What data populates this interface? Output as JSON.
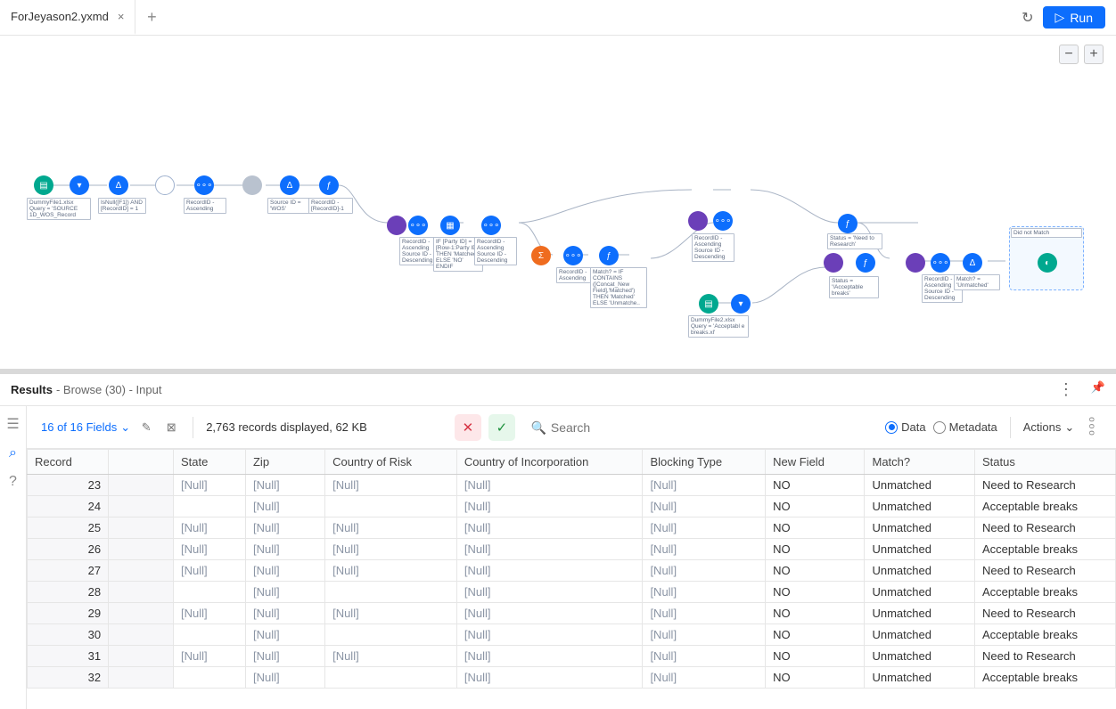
{
  "tabs": [
    {
      "label": "ForJeyason2.yxmd"
    }
  ],
  "run_label": "Run",
  "canvas": {
    "nodes": {
      "input1_label": "DummyFile1.xlsx\nQuery = 'SOURCE\n1D_WOS_Record",
      "formula1_label": "IsNull([F1])\nAND\n[RecordID] = 1",
      "sort1_label": "RecordID -\nAscending",
      "select1_label": "Source ID =\n'WOS'",
      "formula2_label": "RecordID -\n[RecordID]-1",
      "sort2_label": "RecordID -\nAscending\nSource ID -\nDescending",
      "if_label": "IF [Party ID] =\n[Row-1:Party ID]\nTHEN 'Matched'\nELSE 'NO'\nENDIF",
      "sort3_label": "RecordID -\nAscending\nSource ID -\nDescending",
      "sort4_label": "RecordID -\nAscending",
      "match_label": "Match? = IF\nCONTAINS\n([Concat_New\nField],'Matched')\nTHEN 'Matched'\nELSE 'Unmatche..",
      "sort5_label": "RecordID -\nAscending\nSource ID -\nDescending",
      "input2_label": "DummyFile2.xlsx\nQuery = 'Acceptabl\ne breaks.xl'",
      "status1_label": "Status = 'Need to\nResearch'",
      "status2_label": "Status =\n'!Acceptable\nbreaks'",
      "sort6_label": "RecordID -\nAscending\nSource ID -\nDescending",
      "match2_label": "Match? =\n'Unmatched'",
      "container_label": "Did not Match"
    }
  },
  "results": {
    "title_bold": "Results",
    "title_rest": "- Browse (30) - Input",
    "fields_link": "16 of 16 Fields",
    "records_text": "2,763 records displayed, 62 KB",
    "search_placeholder": "Search",
    "view_data": "Data",
    "view_metadata": "Metadata",
    "actions_label": "Actions",
    "more_label": "ooo"
  },
  "table": {
    "columns": [
      "Record",
      "",
      "State",
      "Zip",
      "Country of Risk",
      "Country of Incorporation",
      "Blocking Type",
      "New Field",
      "Match?",
      "Status"
    ],
    "rows": [
      {
        "rec": "23",
        "state": "[Null]",
        "zip": "[Null]",
        "cor": "[Null]",
        "coi": "[Null]",
        "bt": "[Null]",
        "nf": "NO",
        "match": "Unmatched",
        "status": "Need to Research"
      },
      {
        "rec": "24",
        "state": "",
        "zip": "[Null]",
        "cor": "",
        "coi": "[Null]",
        "bt": "[Null]",
        "nf": "NO",
        "match": "Unmatched",
        "status": "Acceptable breaks"
      },
      {
        "rec": "25",
        "state": "[Null]",
        "zip": "[Null]",
        "cor": "[Null]",
        "coi": "[Null]",
        "bt": "[Null]",
        "nf": "NO",
        "match": "Unmatched",
        "status": "Need to Research"
      },
      {
        "rec": "26",
        "state": "[Null]",
        "zip": "[Null]",
        "cor": "[Null]",
        "coi": "[Null]",
        "bt": "[Null]",
        "nf": "NO",
        "match": "Unmatched",
        "status": "Acceptable breaks"
      },
      {
        "rec": "27",
        "state": "[Null]",
        "zip": "[Null]",
        "cor": "[Null]",
        "coi": "[Null]",
        "bt": "[Null]",
        "nf": "NO",
        "match": "Unmatched",
        "status": "Need to Research"
      },
      {
        "rec": "28",
        "state": "",
        "zip": "[Null]",
        "cor": "",
        "coi": "[Null]",
        "bt": "[Null]",
        "nf": "NO",
        "match": "Unmatched",
        "status": "Acceptable breaks"
      },
      {
        "rec": "29",
        "state": "[Null]",
        "zip": "[Null]",
        "cor": "[Null]",
        "coi": "[Null]",
        "bt": "[Null]",
        "nf": "NO",
        "match": "Unmatched",
        "status": "Need to Research"
      },
      {
        "rec": "30",
        "state": "",
        "zip": "[Null]",
        "cor": "",
        "coi": "[Null]",
        "bt": "[Null]",
        "nf": "NO",
        "match": "Unmatched",
        "status": "Acceptable breaks"
      },
      {
        "rec": "31",
        "state": "[Null]",
        "zip": "[Null]",
        "cor": "[Null]",
        "coi": "[Null]",
        "bt": "[Null]",
        "nf": "NO",
        "match": "Unmatched",
        "status": "Need to Research"
      },
      {
        "rec": "32",
        "state": "",
        "zip": "[Null]",
        "cor": "",
        "coi": "[Null]",
        "bt": "[Null]",
        "nf": "NO",
        "match": "Unmatched",
        "status": "Acceptable breaks"
      }
    ]
  }
}
